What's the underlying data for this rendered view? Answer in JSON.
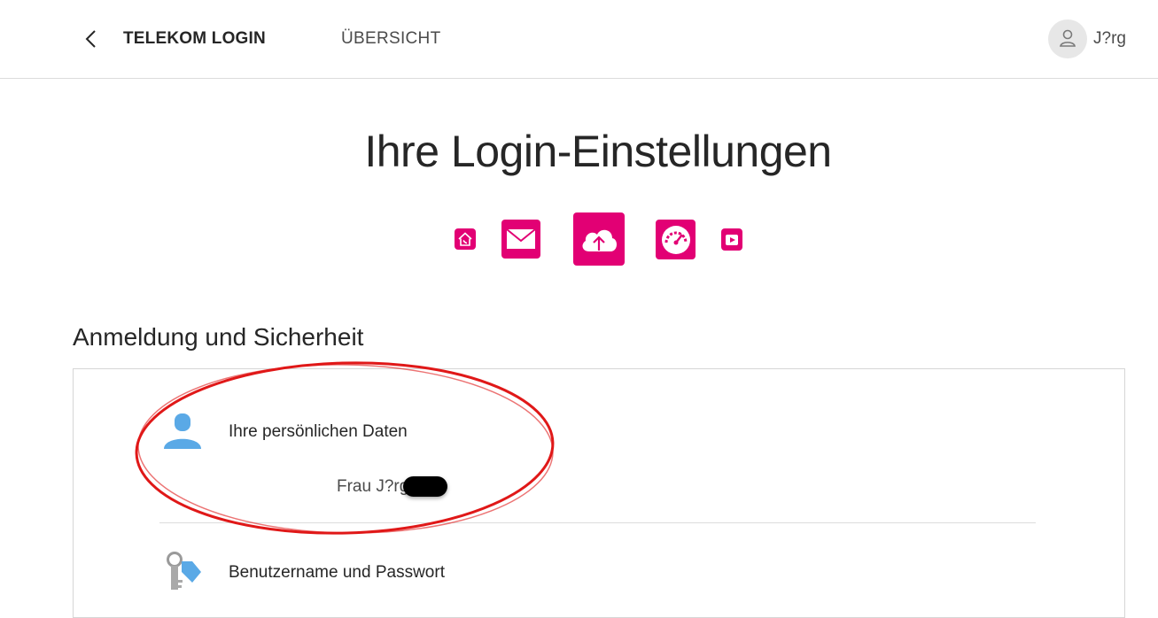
{
  "header": {
    "back_icon": "chevron-left-icon",
    "brand": "TELEKOM LOGIN",
    "nav_overview": "ÜBERSICHT",
    "user_icon": "user-icon",
    "user_name": "J?rg"
  },
  "main": {
    "title": "Ihre Login-Einstellungen",
    "app_icons": [
      {
        "name": "home-phone-icon"
      },
      {
        "name": "mail-icon"
      },
      {
        "name": "cloud-upload-icon"
      },
      {
        "name": "speedometer-icon"
      },
      {
        "name": "tv-play-icon"
      }
    ],
    "accent_color": "#e20074"
  },
  "security": {
    "section_title": "Anmeldung und Sicherheit",
    "items": [
      {
        "label": "Ihre persönlichen Daten",
        "value": "Frau J?rg",
        "icon": "person-icon"
      },
      {
        "label": "Benutzername und Passwort",
        "icon": "key-icon"
      }
    ]
  }
}
